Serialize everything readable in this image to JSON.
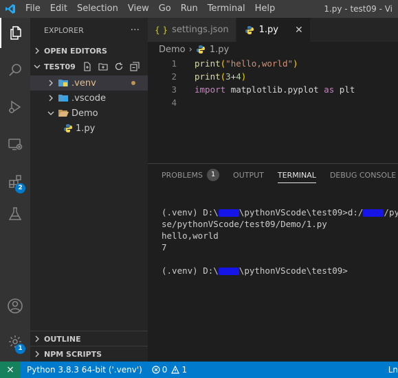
{
  "titlebar": {
    "menu": [
      "File",
      "Edit",
      "Selection",
      "View",
      "Go",
      "Run",
      "Terminal",
      "Help"
    ],
    "title": "1.py - test09 - Vi"
  },
  "activity": {
    "extensions_badge": "2",
    "manage_badge": "1"
  },
  "sidebar": {
    "header": "EXPLORER",
    "more": "···",
    "open_editors": "OPEN EDITORS",
    "root": "TEST09",
    "tree": [
      {
        "label": ".venv",
        "color": "#e2c08d"
      },
      {
        "label": ".vscode",
        "color": "#cccccc"
      },
      {
        "label": "Demo",
        "color": "#cccccc"
      },
      {
        "label": "1.py",
        "color": "#cccccc"
      }
    ],
    "outline": "OUTLINE",
    "npm": "NPM SCRIPTS"
  },
  "tabs": [
    {
      "label": "settings.json",
      "icon": "{ }"
    },
    {
      "label": "1.py",
      "close": "✕"
    }
  ],
  "breadcrumb": {
    "folder": "Demo",
    "sep": "›",
    "file": "1.py"
  },
  "editor": {
    "lines": [
      {
        "num": "1",
        "parts": [
          "print",
          "(",
          "\"hello,world\"",
          ")"
        ]
      },
      {
        "num": "2",
        "parts": [
          "print",
          "(",
          "3",
          "+",
          "4",
          ")"
        ]
      },
      {
        "num": "3",
        "parts": [
          "import",
          " ",
          "matplotlib",
          ".",
          "pyplot",
          " ",
          "as",
          " ",
          "plt"
        ]
      },
      {
        "num": "4",
        "parts": []
      }
    ]
  },
  "panel": {
    "tabs": [
      "PROBLEMS",
      "OUTPUT",
      "TERMINAL",
      "DEBUG CONSOLE"
    ],
    "problems_count": "1",
    "terminal": {
      "l1a": "(.venv) D:\\",
      "l1b": "\\pythonVScode\\test09>d:/",
      "l1c": "/pytho",
      "l2": "se/pythonVScode/test09/Demo/1.py",
      "l3": "hello,world",
      "l4": "7",
      "l5a": "(.venv) D:\\",
      "l5b": "\\pythonVScode\\test09>"
    }
  },
  "status": {
    "remote": "⨯",
    "python": "Python 3.8.3 64-bit ('.venv')",
    "errors": "0",
    "warnings": "1",
    "ln": "Ln"
  }
}
